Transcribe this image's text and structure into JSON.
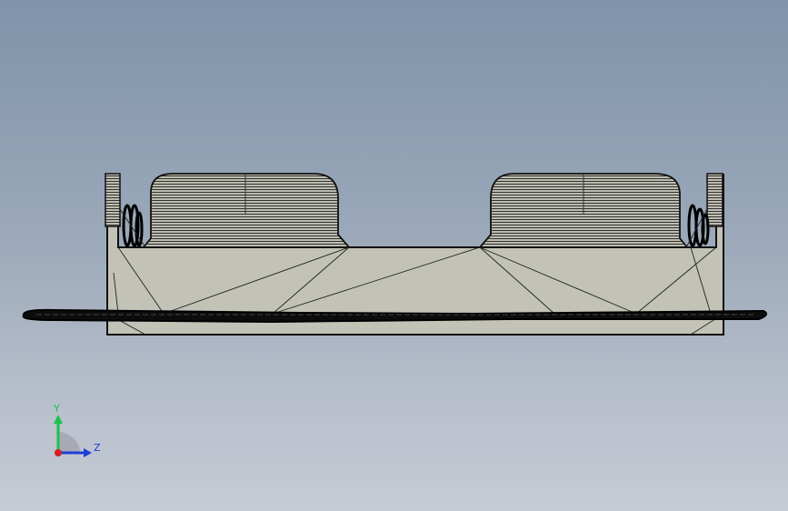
{
  "viewport": {
    "background_top": "#7f93aa",
    "background_bottom": "#c6cbd4"
  },
  "model": {
    "name": "cad-part-side-view",
    "fill_color": "#c2c2b6",
    "edge_color": "#111111"
  },
  "triad": {
    "y_label": "Y",
    "z_label": "Z",
    "y_color": "#19c34a",
    "z_color": "#1f3fd6",
    "x_color": "#d42020"
  }
}
